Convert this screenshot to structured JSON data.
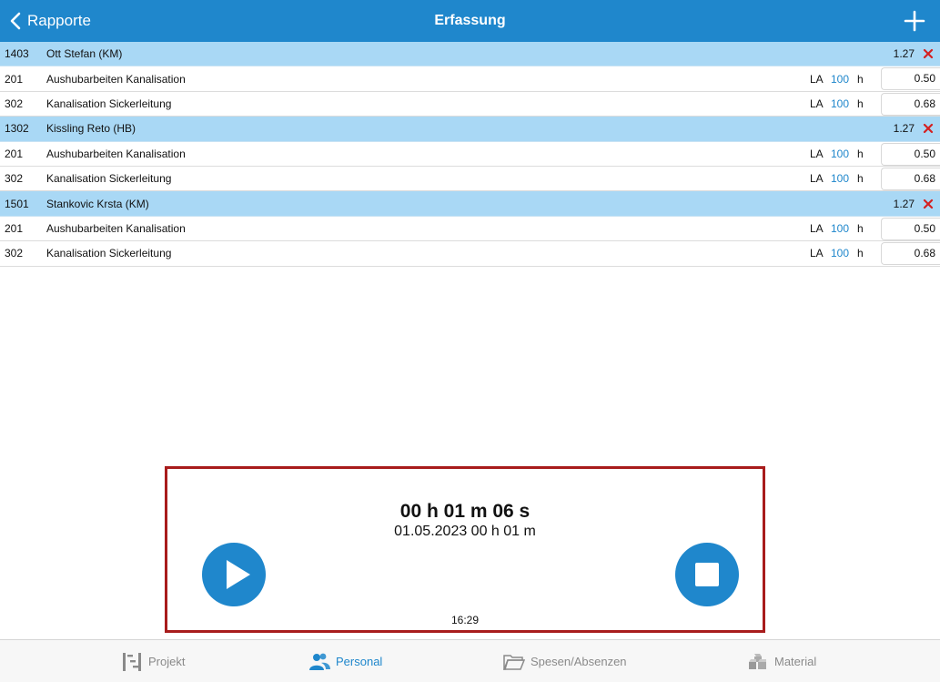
{
  "header": {
    "back_label": "Rapporte",
    "title": "Erfassung"
  },
  "groups": [
    {
      "code": "1403",
      "name": "Ott Stefan (KM)",
      "total": "1.27",
      "items": [
        {
          "code": "201",
          "name": "Aushubarbeiten Kanalisation",
          "la": "LA",
          "pct": "100",
          "unit": "h",
          "hours": "0.50"
        },
        {
          "code": "302",
          "name": "Kanalisation Sickerleitung",
          "la": "LA",
          "pct": "100",
          "unit": "h",
          "hours": "0.68"
        }
      ]
    },
    {
      "code": "1302",
      "name": "Kissling Reto (HB)",
      "total": "1.27",
      "items": [
        {
          "code": "201",
          "name": "Aushubarbeiten Kanalisation",
          "la": "LA",
          "pct": "100",
          "unit": "h",
          "hours": "0.50"
        },
        {
          "code": "302",
          "name": "Kanalisation Sickerleitung",
          "la": "LA",
          "pct": "100",
          "unit": "h",
          "hours": "0.68"
        }
      ]
    },
    {
      "code": "1501",
      "name": "Stankovic Krsta (KM)",
      "total": "1.27",
      "items": [
        {
          "code": "201",
          "name": "Aushubarbeiten Kanalisation",
          "la": "LA",
          "pct": "100",
          "unit": "h",
          "hours": "0.50"
        },
        {
          "code": "302",
          "name": "Kanalisation Sickerleitung",
          "la": "LA",
          "pct": "100",
          "unit": "h",
          "hours": "0.68"
        }
      ]
    }
  ],
  "timer": {
    "elapsed": "00 h 01 m 06 s",
    "datetime": "01.05.2023 00 h 01 m",
    "clock": "16:29"
  },
  "tabs": [
    {
      "label": "Projekt",
      "icon": "project-icon"
    },
    {
      "label": "Personal",
      "icon": "people-icon"
    },
    {
      "label": "Spesen/Absenzen",
      "icon": "folder-icon"
    },
    {
      "label": "Material",
      "icon": "boxes-icon"
    }
  ],
  "colors": {
    "accent": "#1f87cc",
    "group_row": "#a9d8f5",
    "delete": "#d42020",
    "highlight_border": "#a81c1c"
  }
}
